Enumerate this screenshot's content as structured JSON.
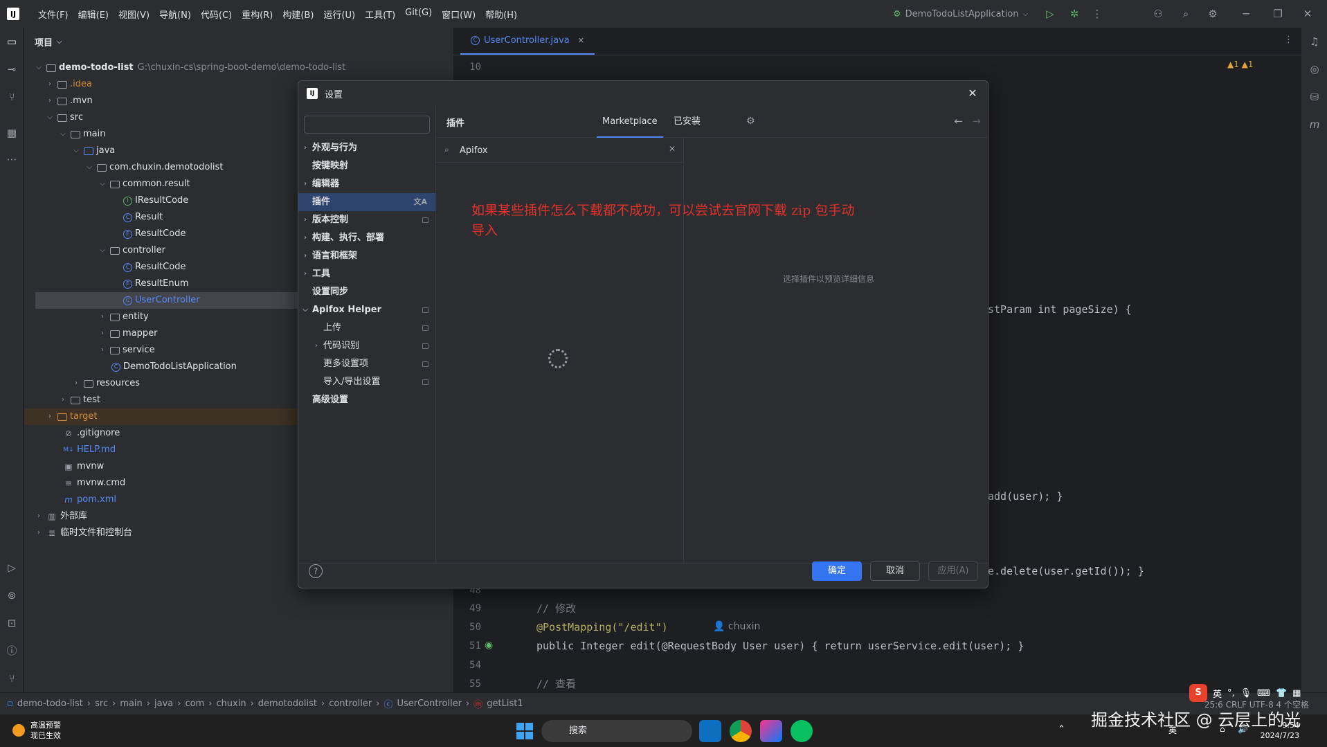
{
  "menu": [
    "文件(F)",
    "编辑(E)",
    "视图(V)",
    "导航(N)",
    "代码(C)",
    "重构(R)",
    "构建(B)",
    "运行(U)",
    "工具(T)",
    "Git(G)",
    "窗口(W)",
    "帮助(H)"
  ],
  "run_config": "DemoTodoListApplication",
  "project_panel": {
    "title": "项目",
    "tree": [
      {
        "label": "demo-todo-list",
        "path": "G:\\chuxin-cs\\spring-boot-demo\\demo-todo-list"
      },
      {
        "label": ".idea"
      },
      {
        "label": ".mvn"
      },
      {
        "label": "src"
      },
      {
        "label": "main"
      },
      {
        "label": "java"
      },
      {
        "label": "com.chuxin.demotodolist"
      },
      {
        "label": "common.result"
      },
      {
        "label": "IResultCode"
      },
      {
        "label": "Result"
      },
      {
        "label": "ResultCode"
      },
      {
        "label": "controller"
      },
      {
        "label": "ResultCode"
      },
      {
        "label": "ResultEnum"
      },
      {
        "label": "UserController"
      },
      {
        "label": "entity"
      },
      {
        "label": "mapper"
      },
      {
        "label": "service"
      },
      {
        "label": "DemoTodoListApplication"
      },
      {
        "label": "resources"
      },
      {
        "label": "test"
      },
      {
        "label": "target"
      },
      {
        "label": ".gitignore"
      },
      {
        "label": "HELP.md"
      },
      {
        "label": "mvnw"
      },
      {
        "label": "mvnw.cmd"
      },
      {
        "label": "pom.xml"
      },
      {
        "label": "外部库"
      },
      {
        "label": "临时文件和控制台"
      }
    ]
  },
  "editor": {
    "tab": "UserController.java",
    "warnings": "▲1  ▲1",
    "lines": [
      {
        "n": "10",
        "code": ""
      },
      {
        "n": "",
        "code": "stParam int pageSize) {"
      },
      {
        "n": "",
        "code": "add(user); }"
      },
      {
        "n": "48",
        "code": "e.delete(user.getId()); }"
      },
      {
        "n": "49",
        "code": "// 修改"
      },
      {
        "n": "50",
        "code": "@PostMapping(\"/edit\")"
      },
      {
        "n": "51",
        "code": "public Integer edit(@RequestBody User user) { return userService.edit(user); }"
      },
      {
        "n": "54",
        "code": ""
      },
      {
        "n": "55",
        "code": "// 查看"
      }
    ],
    "author_hint": "chuxin"
  },
  "dialog": {
    "title": "设置",
    "search_placeholder": "",
    "nav": [
      {
        "label": "外观与行为"
      },
      {
        "label": "按键映射"
      },
      {
        "label": "编辑器"
      },
      {
        "label": "插件"
      },
      {
        "label": "版本控制"
      },
      {
        "label": "构建、执行、部署"
      },
      {
        "label": "语言和框架"
      },
      {
        "label": "工具"
      },
      {
        "label": "设置同步"
      },
      {
        "label": "Apifox Helper"
      },
      {
        "label": "上传"
      },
      {
        "label": "代码识别"
      },
      {
        "label": "更多设置项"
      },
      {
        "label": "导入/导出设置"
      },
      {
        "label": "高级设置"
      }
    ],
    "plugins": {
      "title": "插件",
      "tabs": [
        "Marketplace",
        "已安装"
      ],
      "search_value": "Apifox",
      "detail_empty": "选择插件以预览详细信息"
    },
    "annotation": "如果某些插件怎么下载都不成功，可以尝试去官网下载 zip 包手动导入",
    "buttons": {
      "ok": "确定",
      "cancel": "取消",
      "apply": "应用(A)",
      "help": "?"
    }
  },
  "statusbar": {
    "breadcrumb": [
      "demo-todo-list",
      "src",
      "main",
      "java",
      "com",
      "chuxin",
      "demotodolist",
      "controller",
      "UserController",
      "getList1"
    ],
    "right": "25:6   CRLF   UTF-8   4 个空格"
  },
  "taskbar": {
    "weather_line1": "高温预警",
    "weather_line2": "现已生效",
    "search": "搜索",
    "time": "9:54",
    "date": "2024/7/23",
    "ime": "英"
  },
  "watermark": "掘金技术社区 @ 云层上的光"
}
